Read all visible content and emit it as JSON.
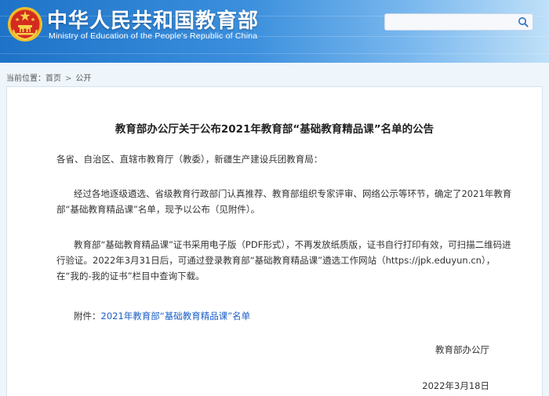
{
  "header": {
    "title_cn": "中华人民共和国教育部",
    "title_en": "Ministry of Education of the People's Republic of China",
    "emblem_icon": "national-emblem-icon",
    "gradient_colors": [
      "#1e73c8",
      "#bfe0f8"
    ]
  },
  "search": {
    "value": "",
    "placeholder": "",
    "icon": "search-icon"
  },
  "breadcrumb": {
    "label": "当前位置：",
    "home": "首页",
    "separator": ">",
    "current": "公开"
  },
  "article": {
    "title": "教育部办公厅关于公布2021年教育部“基础教育精品课”名单的公告",
    "salutation": "各省、自治区、直辖市教育厅（教委），新疆生产建设兵团教育局：",
    "paragraph1": "经过各地逐级遴选、省级教育行政部门认真推荐、教育部组织专家评审、网络公示等环节，确定了2021年教育部“基础教育精品课”名单，现予以公布（见附件）。",
    "paragraph2": "教育部“基础教育精品课”证书采用电子版（PDF形式），不再发放纸质版，证书自行打印有效，可扫描二维码进行验证。2022年3月31日后，可通过登录教育部“基础教育精品课”遴选工作网站（https://jpk.eduyun.cn），在“我的-我的证书”栏目中查询下载。",
    "attachment_label": "附件：",
    "attachment_link": "2021年教育部“基础教育精品课”名单",
    "signature": "教育部办公厅",
    "date": "2022年3月18日"
  },
  "colors": {
    "page_bg": "#eef5fb",
    "link": "#1c5fc7",
    "emblem_red": "#d42a1f",
    "emblem_gold": "#f2c230"
  }
}
